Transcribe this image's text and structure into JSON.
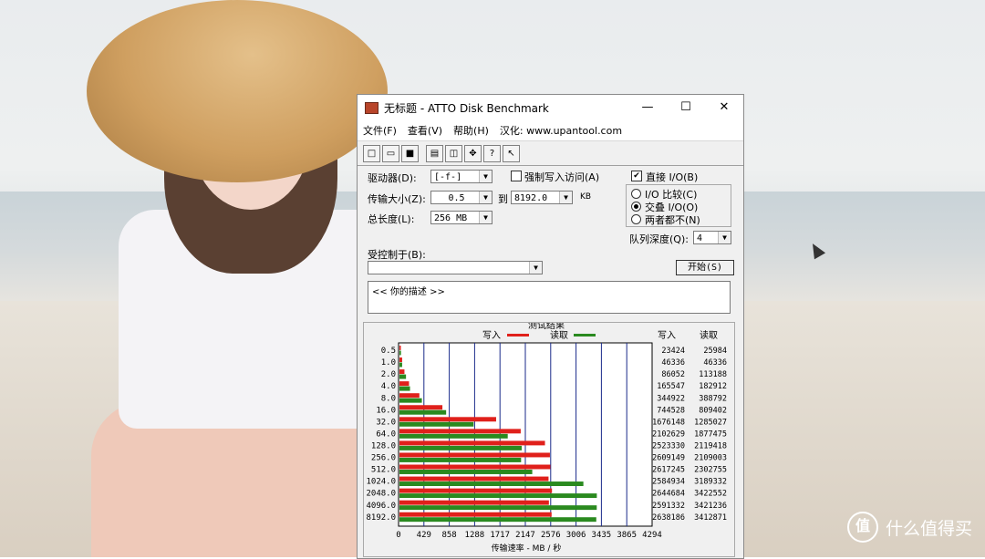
{
  "background": {
    "watermark_text": "什么值得买",
    "watermark_logo": "值"
  },
  "window": {
    "title": "无标题 - ATTO Disk Benchmark",
    "controls": {
      "minimize": "—",
      "maximize": "☐",
      "close": "✕"
    },
    "menu": [
      "文件(F)",
      "查看(V)",
      "帮助(H)",
      "汉化: www.upantool.com"
    ],
    "toolbar_icons": [
      "new-icon",
      "open-icon",
      "save-icon",
      "print-icon",
      "print-preview-icon",
      "move-icon",
      "help-icon",
      "context-help-icon"
    ]
  },
  "settings": {
    "drive_label": "驱动器(D):",
    "drive_value": "[-f-]",
    "force_write_label": "强制写入访问(A)",
    "force_write_checked": false,
    "direct_io_label": "直接 I/O(B)",
    "direct_io_checked": true,
    "transfer_label": "传输大小(Z):",
    "transfer_from": "0.5",
    "to_label": "到",
    "transfer_to": "8192.0",
    "kb_unit": "KB",
    "total_label": "总长度(L):",
    "total_value": "256 MB",
    "io_compare_label": "I/O 比较(C)",
    "overlapped_label": "交叠 I/O(O)",
    "neither_label": "两者都不(N)",
    "selected_mode": "overlapped",
    "queue_label": "队列深度(Q):",
    "queue_value": "4",
    "controlled_by_label": "受控制于(B):",
    "controlled_by_value": "",
    "start_button": "开始(S)",
    "description_text": "<<   你的描述    >>"
  },
  "results": {
    "box_title": "测试结果",
    "write_legend": "写入",
    "read_legend": "读取",
    "write_header": "写入",
    "read_header": "读取",
    "write_color": "#e0201b",
    "read_color": "#2a8a1f",
    "xlabel": "传输速率 - MB / 秒"
  },
  "chart_data": {
    "type": "bar",
    "orientation": "horizontal",
    "title": "测试结果",
    "xlabel": "传输速率 - MB / 秒",
    "x_ticks": [
      "0",
      "429",
      "858",
      "1288",
      "1717",
      "2147",
      "2576",
      "3006",
      "3435",
      "3865",
      "4294"
    ],
    "xlim": [
      0,
      4294
    ],
    "categories": [
      "0.5",
      "1.0",
      "2.0",
      "4.0",
      "8.0",
      "16.0",
      "32.0",
      "64.0",
      "128.0",
      "256.0",
      "512.0",
      "1024.0",
      "2048.0",
      "4096.0",
      "8192.0"
    ],
    "series": [
      {
        "name": "写入",
        "color": "#e0201b",
        "values": [
          23424,
          46336,
          86052,
          165547,
          344922,
          744528,
          1676148,
          2102629,
          2523330,
          2609149,
          2617245,
          2584934,
          2644684,
          2591332,
          2638186
        ]
      },
      {
        "name": "读取",
        "color": "#2a8a1f",
        "values": [
          25984,
          46336,
          113188,
          182912,
          388792,
          809402,
          1285027,
          1877475,
          2119418,
          2109003,
          2302755,
          3189332,
          3422552,
          3421236,
          3412871
        ]
      }
    ]
  }
}
